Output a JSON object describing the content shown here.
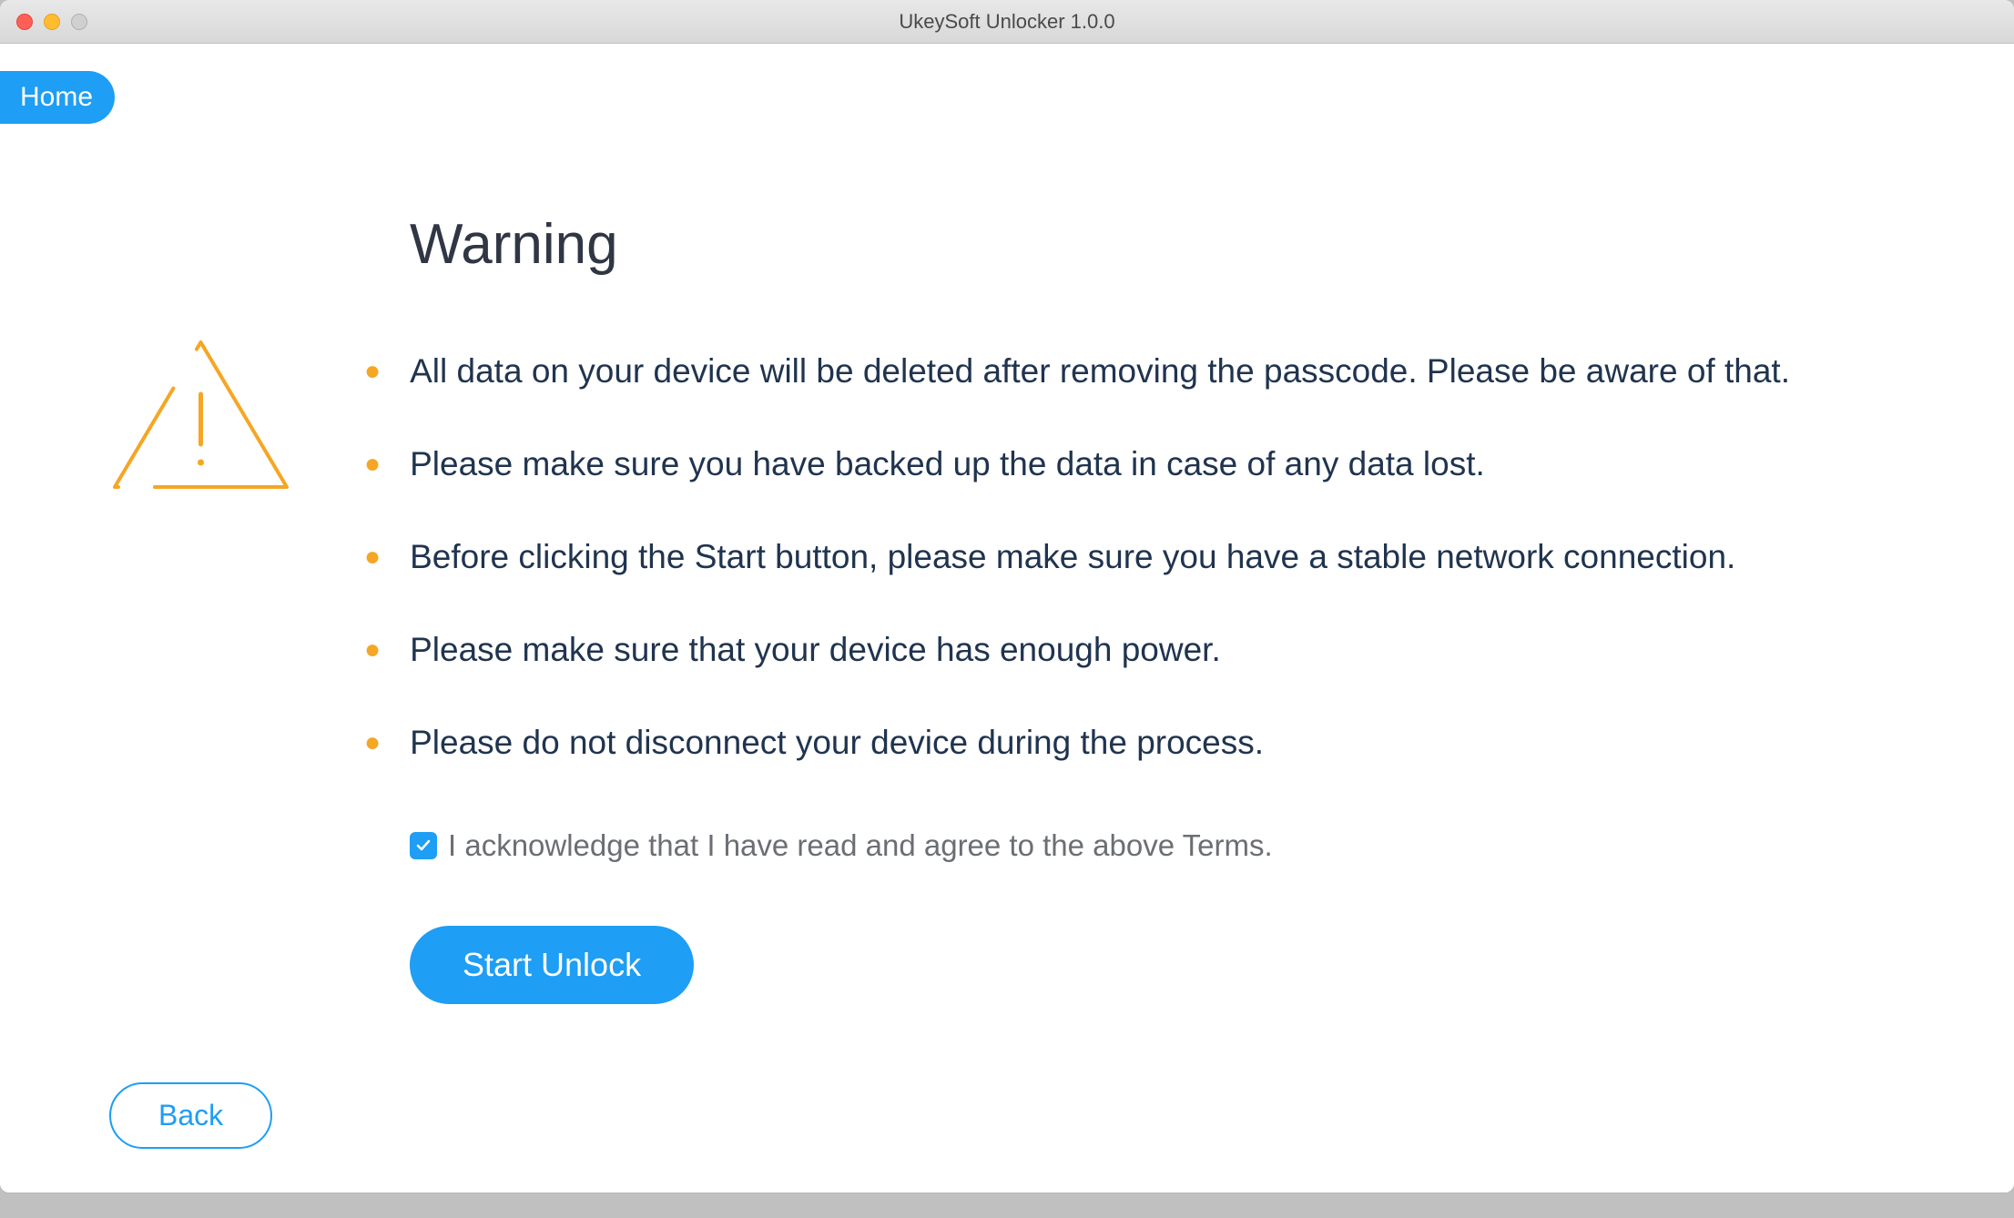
{
  "window": {
    "title": "UkeySoft Unlocker 1.0.0"
  },
  "nav": {
    "home_label": "Home"
  },
  "heading": "Warning",
  "bullets": [
    "All data on your device will be deleted after removing the passcode. Please be aware of that.",
    "Please make sure you have backed up the data in case of any data lost.",
    "Before clicking the Start button, please make sure you have a stable network connection.",
    "Please make sure that your device has enough power.",
    "Please do not disconnect your device during the process."
  ],
  "acknowledge": {
    "label": "I acknowledge that I have read and agree to the above Terms.",
    "checked": true
  },
  "actions": {
    "start_label": "Start Unlock",
    "back_label": "Back"
  }
}
